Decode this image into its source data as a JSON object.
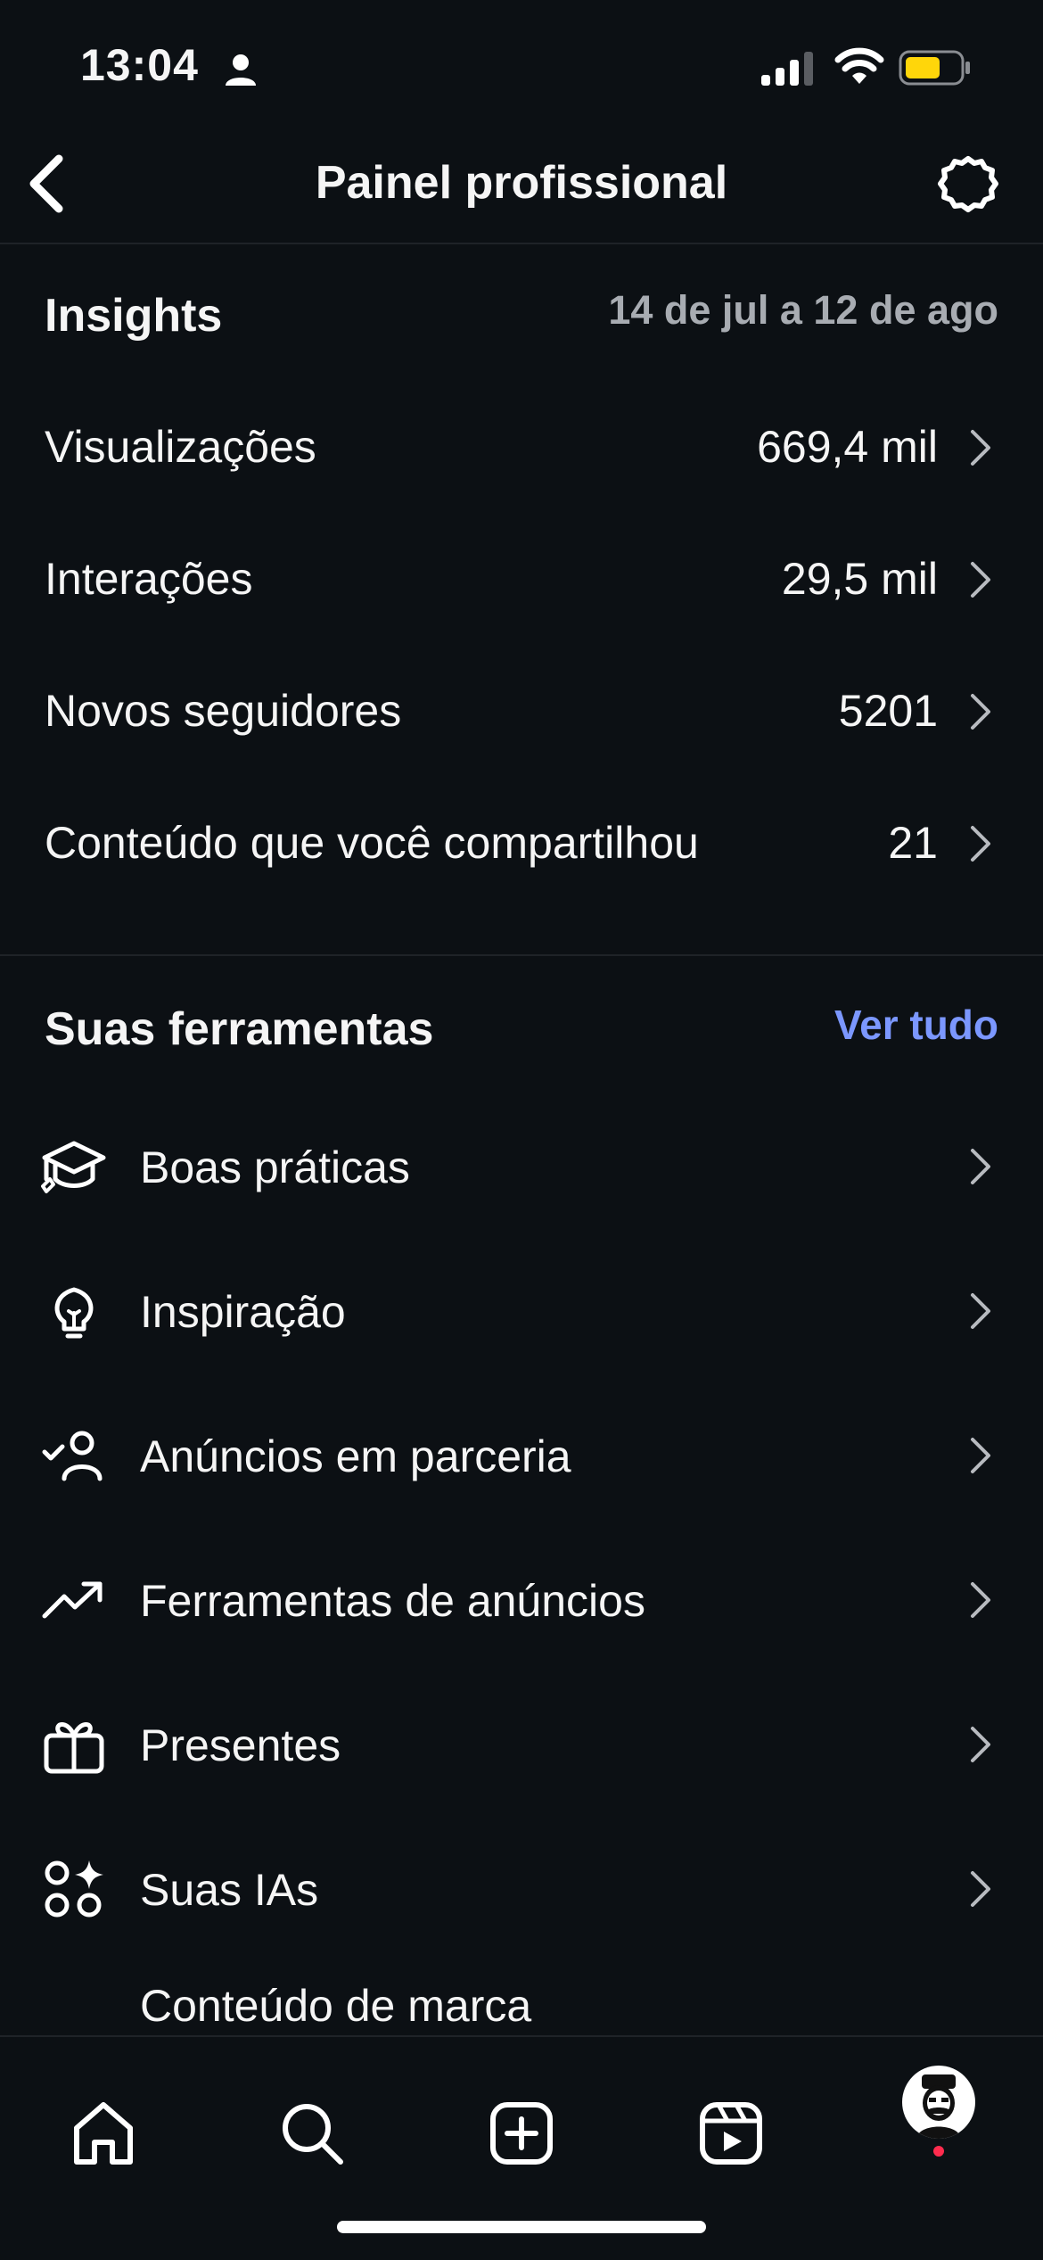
{
  "status_bar": {
    "time": "13:04"
  },
  "header": {
    "title": "Painel profissional"
  },
  "insights": {
    "title": "Insights",
    "date_range": "14 de jul a 12 de ago",
    "rows": [
      {
        "label": "Visualizações",
        "value": "669,4 mil"
      },
      {
        "label": "Interações",
        "value": "29,5 mil"
      },
      {
        "label": "Novos seguidores",
        "value": "5201"
      },
      {
        "label": "Conteúdo que você compartilhou",
        "value": "21"
      }
    ]
  },
  "tools": {
    "title": "Suas ferramentas",
    "see_all": "Ver tudo",
    "items": [
      {
        "label": "Boas práticas",
        "icon": "graduation-cap-icon"
      },
      {
        "label": "Inspiração",
        "icon": "lightbulb-icon"
      },
      {
        "label": "Anúncios em parceria",
        "icon": "person-check-icon"
      },
      {
        "label": "Ferramentas de anúncios",
        "icon": "trending-up-icon"
      },
      {
        "label": "Presentes",
        "icon": "gift-icon"
      },
      {
        "label": "Suas IAs",
        "icon": "ai-sparkle-icon"
      },
      {
        "label": "Conteúdo de marca",
        "icon": ""
      }
    ]
  },
  "bottom_nav": [
    "home-icon",
    "search-icon",
    "create-icon",
    "reels-icon",
    "profile-avatar"
  ],
  "colors": {
    "background": "#0c1014",
    "accent": "#7b97ff",
    "muted": "#a8acb2",
    "battery": "#ffd60a",
    "notification": "#ff2c4e"
  }
}
